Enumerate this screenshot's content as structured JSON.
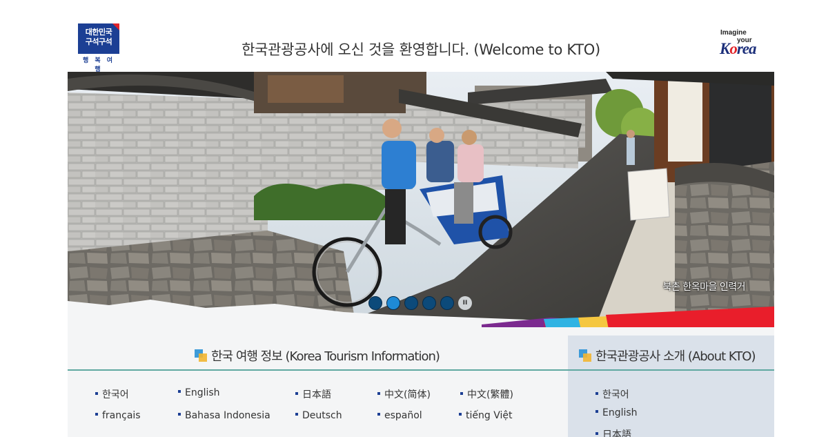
{
  "header": {
    "left_logo_line1": "대한민국",
    "left_logo_line2": "구석구석",
    "left_logo_sub": "행 복 여 행",
    "welcome": "한국관광공사에 오신 것을 환영합니다. (Welcome to KTO)",
    "right_logo_imagine": "Imagine",
    "right_logo_your": "your",
    "right_logo_korea_pre": "K",
    "right_logo_korea_o": "o",
    "right_logo_korea_post": "rea"
  },
  "hero": {
    "caption": "북촌 한옥마을 인력거",
    "slides": 5,
    "active_slide": 2,
    "pause_label": "II"
  },
  "tourism": {
    "title": "한국 여행 정보 (Korea Tourism Information)",
    "languages": [
      "한국어",
      "English",
      "日本語",
      "中文(简体)",
      "中文(繁體)",
      "français",
      "Bahasa Indonesia",
      "Deutsch",
      "español",
      "tiếng Việt"
    ]
  },
  "about": {
    "title": "한국관광공사 소개 (About KTO)",
    "languages": [
      "한국어",
      "English",
      "日本語"
    ]
  },
  "colors": {
    "brand_blue": "#1c3f94",
    "brand_red": "#e2242a",
    "dot_active": "#1e8ad6",
    "dot_inactive": "#0c4a7a",
    "rule": "#5fa8a0"
  }
}
